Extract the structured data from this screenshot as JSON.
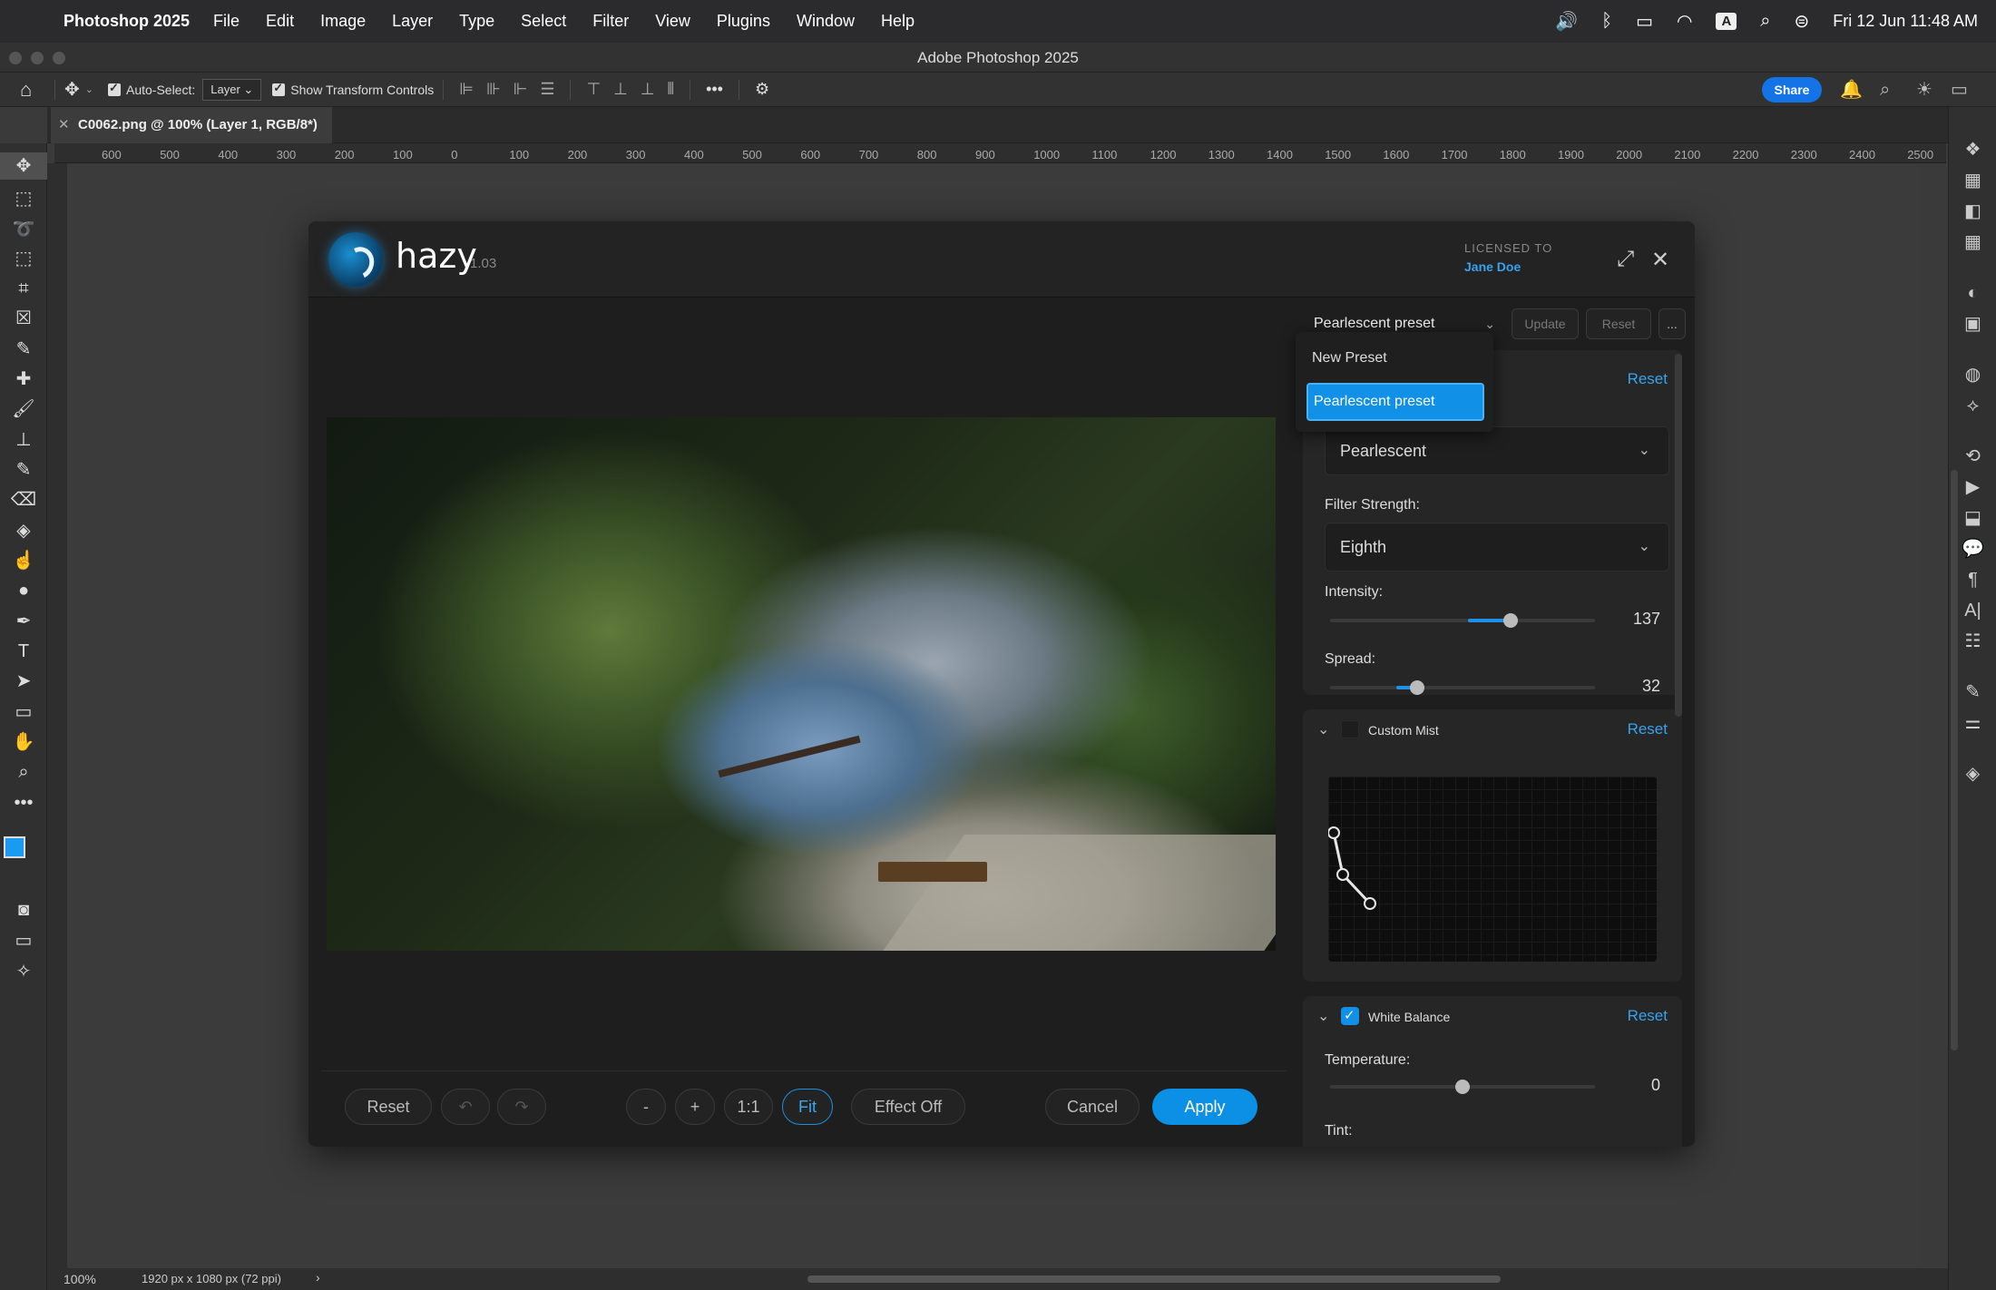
{
  "menubar": {
    "app": "Photoshop 2025",
    "items": [
      "File",
      "Edit",
      "Image",
      "Layer",
      "Type",
      "Select",
      "Filter",
      "View",
      "Plugins",
      "Window",
      "Help"
    ],
    "input_badge": "A",
    "datetime": "Fri 12 Jun  11:48 AM"
  },
  "window": {
    "title": "Adobe Photoshop 2025"
  },
  "options_bar": {
    "auto_select_label": "Auto-Select:",
    "auto_select_value": "Layer",
    "transform_label": "Show Transform Controls",
    "share_label": "Share"
  },
  "document": {
    "tab_title": "C0062.png @ 100% (Layer 1, RGB/8*)",
    "zoom": "100%",
    "dimensions": "1920 px x 1080 px (72 ppi)"
  },
  "ruler": {
    "labels": [
      "600",
      "500",
      "400",
      "300",
      "200",
      "100",
      "0",
      "100",
      "200",
      "300",
      "400",
      "500",
      "600",
      "700",
      "800",
      "900",
      "1000",
      "1100",
      "1200",
      "1300",
      "1400",
      "1500",
      "1600",
      "1700",
      "1800",
      "1900",
      "2000",
      "2100",
      "2200",
      "2300",
      "2400",
      "2500"
    ]
  },
  "plugin": {
    "name": "hazy",
    "version": "1.03",
    "licensed_to_label": "LICENSED TO",
    "licensee": "Jane Doe",
    "preset_selected": "Pearlescent preset",
    "update_label": "Update",
    "reset_label": "Reset",
    "more_label": "...",
    "preset_menu": [
      "New Preset",
      "Pearlescent preset"
    ],
    "mist_section": {
      "reset": "Reset",
      "type_value": "Pearlescent",
      "strength_label": "Filter Strength:",
      "strength_value": "Eighth",
      "intensity_label": "Intensity:",
      "intensity_value": "137",
      "intensity_fraction": 0.68,
      "spread_label": "Spread:",
      "spread_value": "32",
      "spread_fraction": 0.33
    },
    "custom_mist": {
      "title": "Custom Mist",
      "reset": "Reset",
      "enabled": false
    },
    "white_balance": {
      "title": "White Balance",
      "reset": "Reset",
      "enabled": true,
      "temperature_label": "Temperature:",
      "temperature_value": "0",
      "temperature_fraction": 0.5,
      "tint_label": "Tint:"
    },
    "footer": {
      "reset": "Reset",
      "zoom_out": "-",
      "zoom_in": "+",
      "one_to_one": "1:1",
      "fit": "Fit",
      "effect_off": "Effect Off",
      "cancel": "Cancel",
      "apply": "Apply"
    }
  },
  "colors": {
    "accent": "#1190e8",
    "link": "#38a2ee"
  }
}
